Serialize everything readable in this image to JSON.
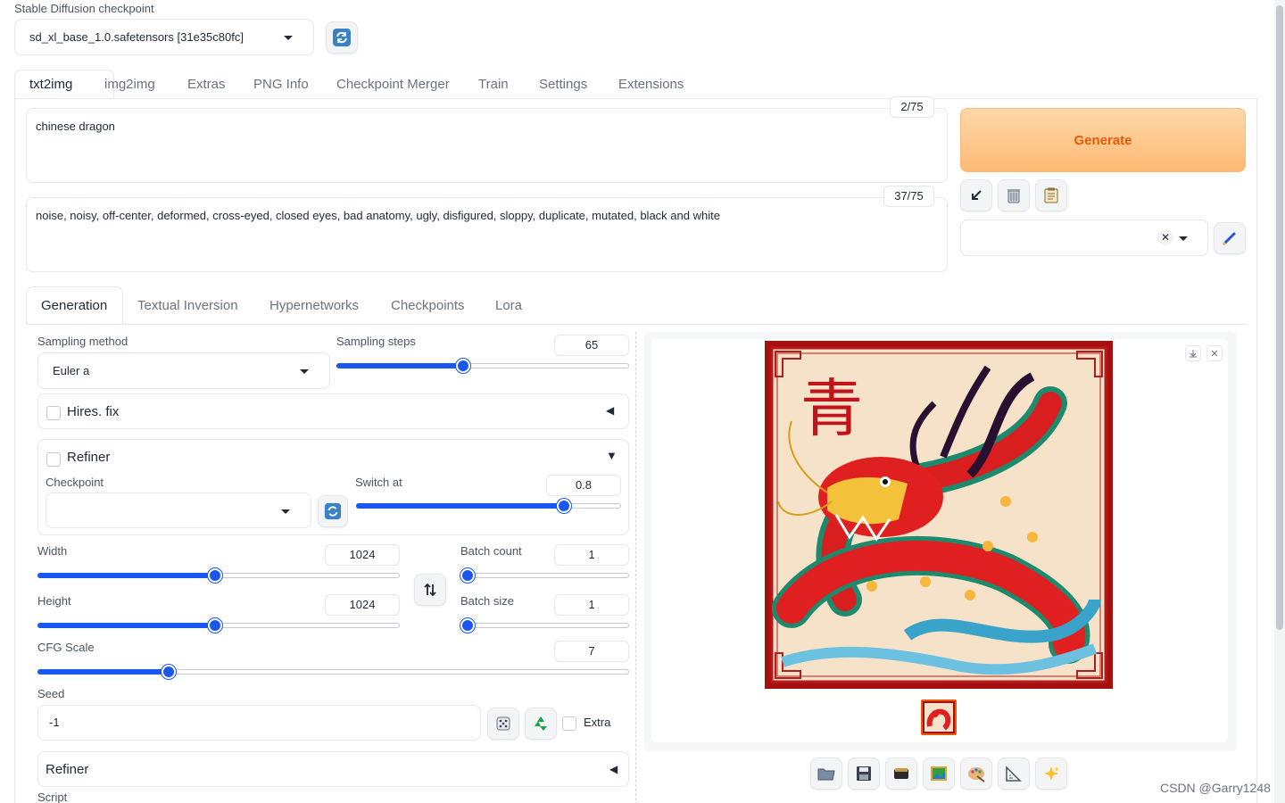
{
  "checkpoint": {
    "label": "Stable Diffusion checkpoint",
    "value": "sd_xl_base_1.0.safetensors [31e35c80fc]"
  },
  "tabs": [
    "txt2img",
    "img2img",
    "Extras",
    "PNG Info",
    "Checkpoint Merger",
    "Train",
    "Settings",
    "Extensions"
  ],
  "prompt": {
    "text": "chinese dragon",
    "token_count": "2/75"
  },
  "negative_prompt": {
    "text": "noise, noisy, off-center, deformed, cross-eyed, closed eyes, bad anatomy, ugly, disfigured, sloppy, duplicate, mutated, black and white",
    "token_count": "37/75"
  },
  "generate_label": "Generate",
  "subtabs": [
    "Generation",
    "Textual Inversion",
    "Hypernetworks",
    "Checkpoints",
    "Lora"
  ],
  "sampling": {
    "method_label": "Sampling method",
    "method_value": "Euler a",
    "steps_label": "Sampling steps",
    "steps_value": "65",
    "steps_fraction": 0.43
  },
  "hires": {
    "label": "Hires. fix"
  },
  "refiner": {
    "label": "Refiner",
    "checkpoint_label": "Checkpoint",
    "switch_label": "Switch at",
    "switch_value": "0.8",
    "switch_fraction": 0.8
  },
  "size": {
    "width_label": "Width",
    "width_value": "1024",
    "width_fraction": 0.49,
    "height_label": "Height",
    "height_value": "1024",
    "height_fraction": 0.49
  },
  "batch": {
    "count_label": "Batch count",
    "count_value": "1",
    "count_fraction": 0.0,
    "size_label": "Batch size",
    "size_value": "1",
    "size_fraction": 0.0
  },
  "cfg": {
    "label": "CFG Scale",
    "value": "7",
    "fraction": 0.215
  },
  "seed": {
    "label": "Seed",
    "value": "-1",
    "extra_label": "Extra"
  },
  "refiner_accordion": {
    "label": "Refiner"
  },
  "script_label": "Script",
  "watermark": "CSDN @Garry1248",
  "colors": {
    "accent": "#1a56f0",
    "generate_text": "#ea580c",
    "generate_bg_top": "#fed7aa",
    "generate_bg_bottom": "#fdba74",
    "dragon_red": "#d81e1e",
    "frame_red": "#a50f0f"
  },
  "icons": [
    "refresh-icon",
    "arrow-down-left-icon",
    "trash-icon",
    "clipboard-icon",
    "clear-x-icon",
    "pencil-icon",
    "swap-icon",
    "dice-icon",
    "recycle-icon",
    "download-icon",
    "close-icon",
    "folder-icon",
    "save-icon",
    "zip-icon",
    "image-icon",
    "palette-icon",
    "ruler-icon",
    "sparkle-icon"
  ]
}
